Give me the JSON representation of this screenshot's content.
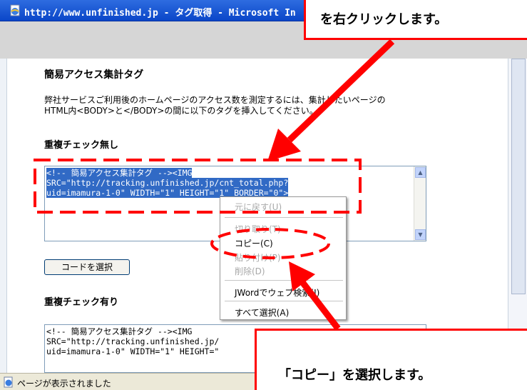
{
  "window": {
    "title": "http://www.unfinished.jp - タグ取得 - Microsoft In",
    "status_text": "ページが表示されました"
  },
  "page": {
    "title": "簡易アクセス集計タグ",
    "description_line1": "弊社サービスご利用後のホームページのアクセス数を測定するには、集計したいページの",
    "description_line2": "HTML内<BODY>と</BODY>の間に以下のタグを挿入してください。",
    "section1_title": "重複チェック無し",
    "section2_title": "重複チェック有り",
    "code1_lines": [
      "<!-- 簡易アクセス集計タグ -->",
      "SRC=\"http://tracking.unfinished.jp/cnt_total.php?",
      "uid=imamura-1-0\" WIDTH=\"1\" HEIGHT=\"1\" BORDER=\"0\">"
    ],
    "code1_img": "<IMG",
    "code2_lines": [
      "<!-- 簡易アクセス集計タグ -->",
      "SRC=\"http://tracking.unfinished.jp/",
      "uid=imamura-1-0\" WIDTH=\"1\" HEIGHT=\""
    ],
    "code2_img": "<IMG",
    "select_code_button": "コードを選択"
  },
  "context_menu": {
    "items": [
      {
        "label": "元に戻す(U)",
        "enabled": false
      },
      {
        "label": "切り取り(T)",
        "enabled": false
      },
      {
        "label": "コピー(C)",
        "enabled": true
      },
      {
        "label": "貼り付け(P)",
        "enabled": false
      },
      {
        "label": "削除(D)",
        "enabled": false
      },
      {
        "label": "JWordでウェブ検索(J)",
        "enabled": true
      },
      {
        "label": "すべて選択(A)",
        "enabled": true
      }
    ]
  },
  "annotations": {
    "top_callout": "を右クリックします。",
    "bottom_callout": "「コピー」を選択します。",
    "color": "#ff0000"
  },
  "icons": {
    "title": "ie-page-icon",
    "status": "ie-page-icon",
    "scroll_up": "triangle-up",
    "scroll_down": "triangle-down"
  }
}
